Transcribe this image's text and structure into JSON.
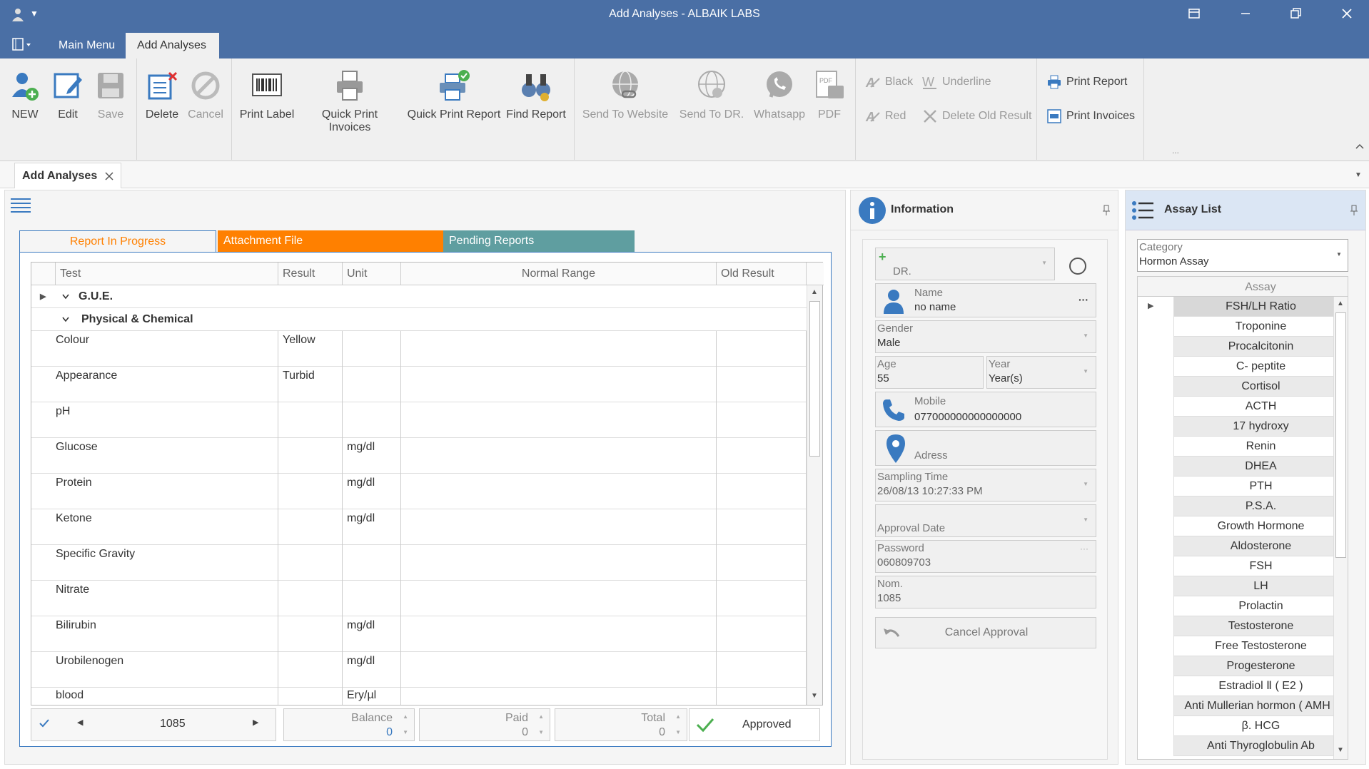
{
  "window": {
    "title": "Add Analyses - ALBAIK LABS"
  },
  "ribbon_tabs": {
    "main_menu": "Main Menu",
    "add_analyses": "Add Analyses"
  },
  "toolbar": {
    "new": "NEW",
    "edit": "Edit",
    "save": "Save",
    "delete": "Delete",
    "cancel": "Cancel",
    "print_label": "Print Label",
    "quick_print_invoices": "Quick Print Invoices",
    "quick_print_report": "Quick Print Report",
    "find_report": "Find Report",
    "send_to_website": "Send To Website",
    "send_to_dr": "Send To DR.",
    "whatsapp": "Whatsapp",
    "pdf": "PDF",
    "black": "Black",
    "underline": "Underline",
    "red": "Red",
    "delete_old_result": "Delete Old Result",
    "print_report": "Print Report",
    "print_invoices": "Print Invoices",
    "more": "..."
  },
  "doc_tab": {
    "label": "Add Analyses"
  },
  "panel_tabs": {
    "in_progress": "Report In Progress",
    "attachment": "Attachment File",
    "pending": "Pending Reports"
  },
  "grid": {
    "columns": [
      "Test",
      "Result",
      "Unit",
      "Normal Range",
      "Old Result"
    ],
    "group1": "G.U.E.",
    "group2": "Physical & Chemical",
    "rows": [
      {
        "test": "Colour",
        "result": "Yellow",
        "unit": ""
      },
      {
        "test": "Appearance",
        "result": "Turbid",
        "unit": ""
      },
      {
        "test": "pH",
        "result": "",
        "unit": ""
      },
      {
        "test": "Glucose",
        "result": "",
        "unit": "mg/dl"
      },
      {
        "test": "Protein",
        "result": "",
        "unit": "mg/dl"
      },
      {
        "test": "Ketone",
        "result": "",
        "unit": "mg/dl"
      },
      {
        "test": "Specific Gravity",
        "result": "",
        "unit": ""
      },
      {
        "test": "Nitrate",
        "result": "",
        "unit": ""
      },
      {
        "test": "Bilirubin",
        "result": "",
        "unit": "mg/dl"
      },
      {
        "test": "Urobilenogen",
        "result": "",
        "unit": "mg/dl"
      },
      {
        "test": "blood",
        "result": "",
        "unit": "Ery/µl"
      }
    ]
  },
  "footer": {
    "record": "1085",
    "balance_label": "Balance",
    "balance": "0",
    "paid_label": "Paid",
    "paid": "0",
    "total_label": "Total",
    "total": "0",
    "approved": "Approved"
  },
  "info": {
    "title": "Information",
    "dr_label": "DR.",
    "name_label": "Name",
    "name": "no name",
    "gender_label": "Gender",
    "gender": "Male",
    "age_label": "Age",
    "age": "55",
    "year_label": "Year",
    "year": "Year(s)",
    "mobile_label": "Mobile",
    "mobile": "077000000000000000",
    "address_label": "Adress",
    "sampling_label": "Sampling Time",
    "sampling": "26/08/13 10:27:33 PM",
    "approval_label": "Approval Date",
    "password_label": "Password",
    "password": "060809703",
    "nom_label": "Nom.",
    "nom": "1085",
    "cancel_approval": "Cancel Approval"
  },
  "assay": {
    "title": "Assay List",
    "category_label": "Category",
    "category": "Hormon Assay",
    "column": "Assay",
    "items": [
      "FSH/LH Ratio",
      "Troponine",
      "Procalcitonin",
      "C- peptite",
      "Cortisol",
      "ACTH",
      "17 hydroxy",
      "Renin",
      "DHEA",
      "PTH",
      "P.S.A.",
      "Growth Hormone",
      "Aldosterone",
      "FSH",
      "LH",
      "Prolactin",
      "Testosterone",
      "Free Testosterone",
      "Progesterone",
      "Estradiol Ⅱ ( E2 )",
      "Anti Mullerian hormon ( AMH )",
      "β. HCG",
      "Anti Thyroglobulin Ab"
    ]
  },
  "colors": {
    "titlebar": "#4a6fa5",
    "attachment_tab": "#ff8000",
    "pending_tab": "#5f9ea0",
    "accent": "#3a7ac0"
  }
}
